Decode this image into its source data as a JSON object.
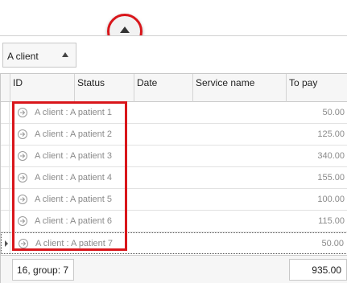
{
  "group_panel": {
    "chip_label": "A client",
    "arrow_icon": "triangle-up-icon"
  },
  "grid": {
    "columns": [
      "ID",
      "Status",
      "Date",
      "Service name",
      "To pay"
    ],
    "rows": [
      {
        "label": "A client : A patient 1",
        "amount": "50.00"
      },
      {
        "label": "A client : A patient 2",
        "amount": "125.00"
      },
      {
        "label": "A client : A patient 3",
        "amount": "340.00"
      },
      {
        "label": "A client : A patient 4",
        "amount": "155.00"
      },
      {
        "label": "A client : A patient 5",
        "amount": "100.00"
      },
      {
        "label": "A client : A patient 6",
        "amount": "115.00"
      },
      {
        "label": "A client : A patient 7",
        "amount": "50.00"
      }
    ]
  },
  "footer": {
    "count_summary": "16, group: 7",
    "total": "935.00"
  },
  "colors": {
    "highlight": "#d9161b",
    "muted_text": "#8a8a8a"
  }
}
